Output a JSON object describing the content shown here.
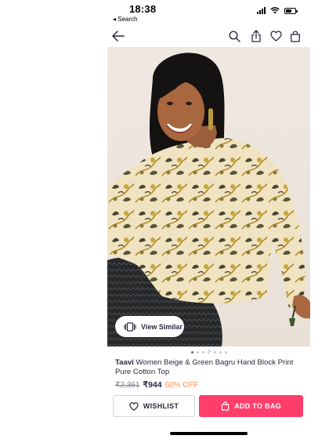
{
  "status_bar": {
    "time": "18:38",
    "back_app": "◂ Search"
  },
  "nav": {
    "icons": [
      "back-arrow-icon",
      "search-icon",
      "share-icon",
      "wishlist-heart-icon",
      "bag-icon"
    ]
  },
  "product": {
    "image_description_icon": "product-photo",
    "view_similar_label": "View Similar",
    "carousel": {
      "count": 7,
      "active_index": 0
    },
    "brand": "Taavi",
    "name": " Women Beige & Green Bagru Hand Block Print Pure Cotton Top",
    "mrp": "₹2,361",
    "price": "₹944",
    "discount": "60% OFF"
  },
  "actions": {
    "wishlist_label": "WISHLIST",
    "add_to_bag_label": "ADD TO BAG"
  },
  "colors": {
    "accent_pink": "#ff3e6c",
    "discount_orange": "#ff905a",
    "text_dark": "#282c3f",
    "text_muted": "#7e818c"
  }
}
